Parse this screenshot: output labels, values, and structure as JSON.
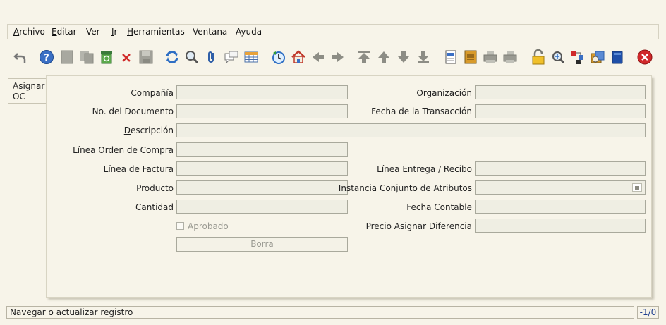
{
  "menu": {
    "archivo": "Archivo",
    "editar": "Editar",
    "ver": "Ver",
    "ir": "Ir",
    "herramientas": "Herramientas",
    "ventana": "Ventana",
    "ayuda": "Ayuda"
  },
  "toolbar": {
    "icons": [
      "undo-icon",
      "help-icon",
      "new-record-icon",
      "copy-record-icon",
      "delete-icon",
      "delete-selection-icon",
      "save-icon",
      "refresh-icon",
      "find-icon",
      "attachment-icon",
      "chat-icon",
      "grid-toggle-icon",
      "history-icon",
      "home-icon",
      "previous-icon",
      "next-icon",
      "first-record-icon",
      "previous-record-icon",
      "next-record-icon",
      "last-record-icon",
      "report-icon",
      "archive-icon",
      "print-preview-icon",
      "print-icon",
      "lock-icon",
      "zoom-across-icon",
      "active-workflows-icon",
      "requests-icon",
      "product-info-icon",
      "exit-icon"
    ]
  },
  "side_tab": {
    "label_line1": "Asignar",
    "label_line2": "OC"
  },
  "form": {
    "compania": "Compañía",
    "organizacion": "Organización",
    "no_documento": "No. del Documento",
    "fecha_transaccion": "Fecha de la Transacción",
    "descripcion_first": "D",
    "descripcion_rest": "escripción",
    "linea_orden_compra": "Línea Orden de Compra",
    "linea_factura": "Línea de Factura",
    "linea_entrega": "Línea Entrega / Recibo",
    "producto": "Producto",
    "instancia_atributos": "Instancia Conjunto de Atributos",
    "cantidad": "Cantidad",
    "fecha_contable_first": "F",
    "fecha_contable_rest": "echa Contable",
    "aprobado": "Aprobado",
    "precio_diferencia": "Precio Asignar Diferencia",
    "borra_button": "Borra",
    "values": {
      "compania": "",
      "organizacion": "",
      "no_documento": "",
      "fecha_transaccion": "",
      "descripcion": "",
      "linea_orden_compra": "",
      "linea_factura": "",
      "linea_entrega": "",
      "producto": "",
      "instancia_atributos": "",
      "cantidad": "",
      "fecha_contable": "",
      "precio_diferencia": ""
    }
  },
  "status": {
    "message": "Navegar o actualizar registro",
    "record_info": "-1/0"
  }
}
